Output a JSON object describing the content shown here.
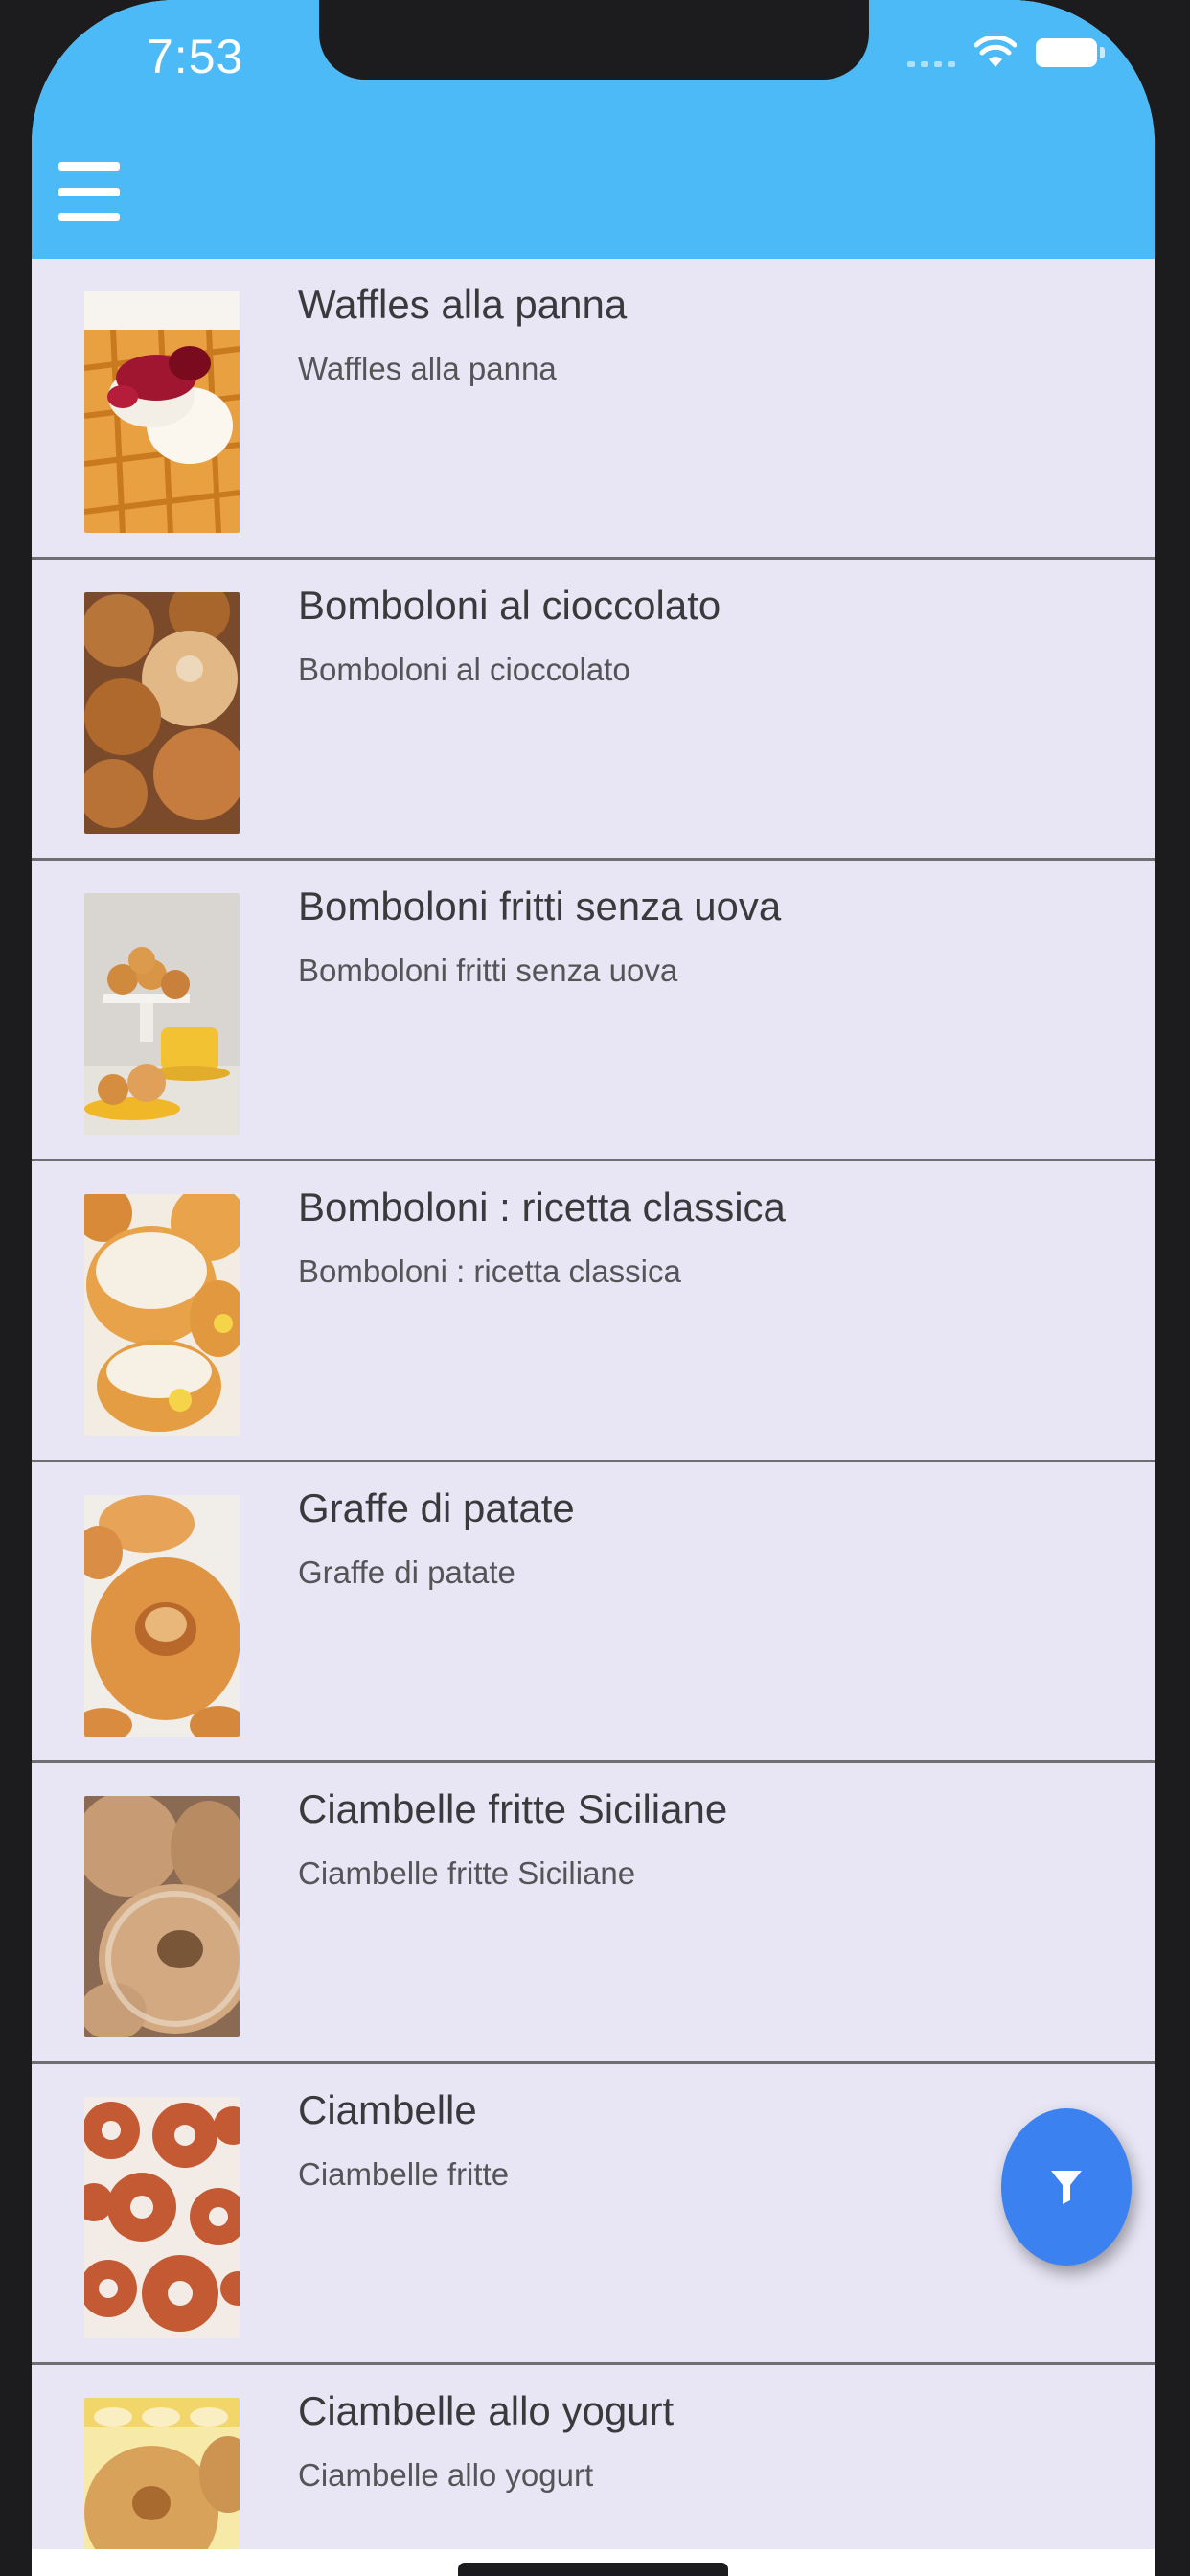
{
  "status_bar": {
    "time": "7:53"
  },
  "app_bar": {
    "background": "#4bbaf7",
    "menu_icon": "hamburger-menu-icon"
  },
  "recipes": [
    {
      "title": "Waffles alla panna",
      "subtitle": "Waffles alla panna",
      "image": "waffles-photo"
    },
    {
      "title": "Bomboloni al cioccolato",
      "subtitle": "Bomboloni al cioccolato",
      "image": "bomboloni-photo"
    },
    {
      "title": "Bomboloni fritti senza uova",
      "subtitle": "Bomboloni fritti senza uova",
      "image": "bomboloni-cups-photo"
    },
    {
      "title": "Bomboloni : ricetta classica",
      "subtitle": "Bomboloni : ricetta classica",
      "image": "bomboloni-cream-photo"
    },
    {
      "title": "Graffe di patate",
      "subtitle": "Graffe di patate",
      "image": "graffe-photo"
    },
    {
      "title": "Ciambelle fritte Siciliane",
      "subtitle": "Ciambelle fritte Siciliane",
      "image": "ciambelle-sugar-photo"
    },
    {
      "title": "Ciambelle",
      "subtitle": "Ciambelle fritte",
      "image": "ciambelle-photo"
    },
    {
      "title": "Ciambelle allo yogurt",
      "subtitle": "Ciambelle allo yogurt",
      "image": "ciambelle-yogurt-photo"
    }
  ],
  "fab": {
    "icon": "filter-icon",
    "color": "#3b82f0"
  },
  "colors": {
    "list_background": "#e8e6f5",
    "divider": "#6e6e73"
  }
}
